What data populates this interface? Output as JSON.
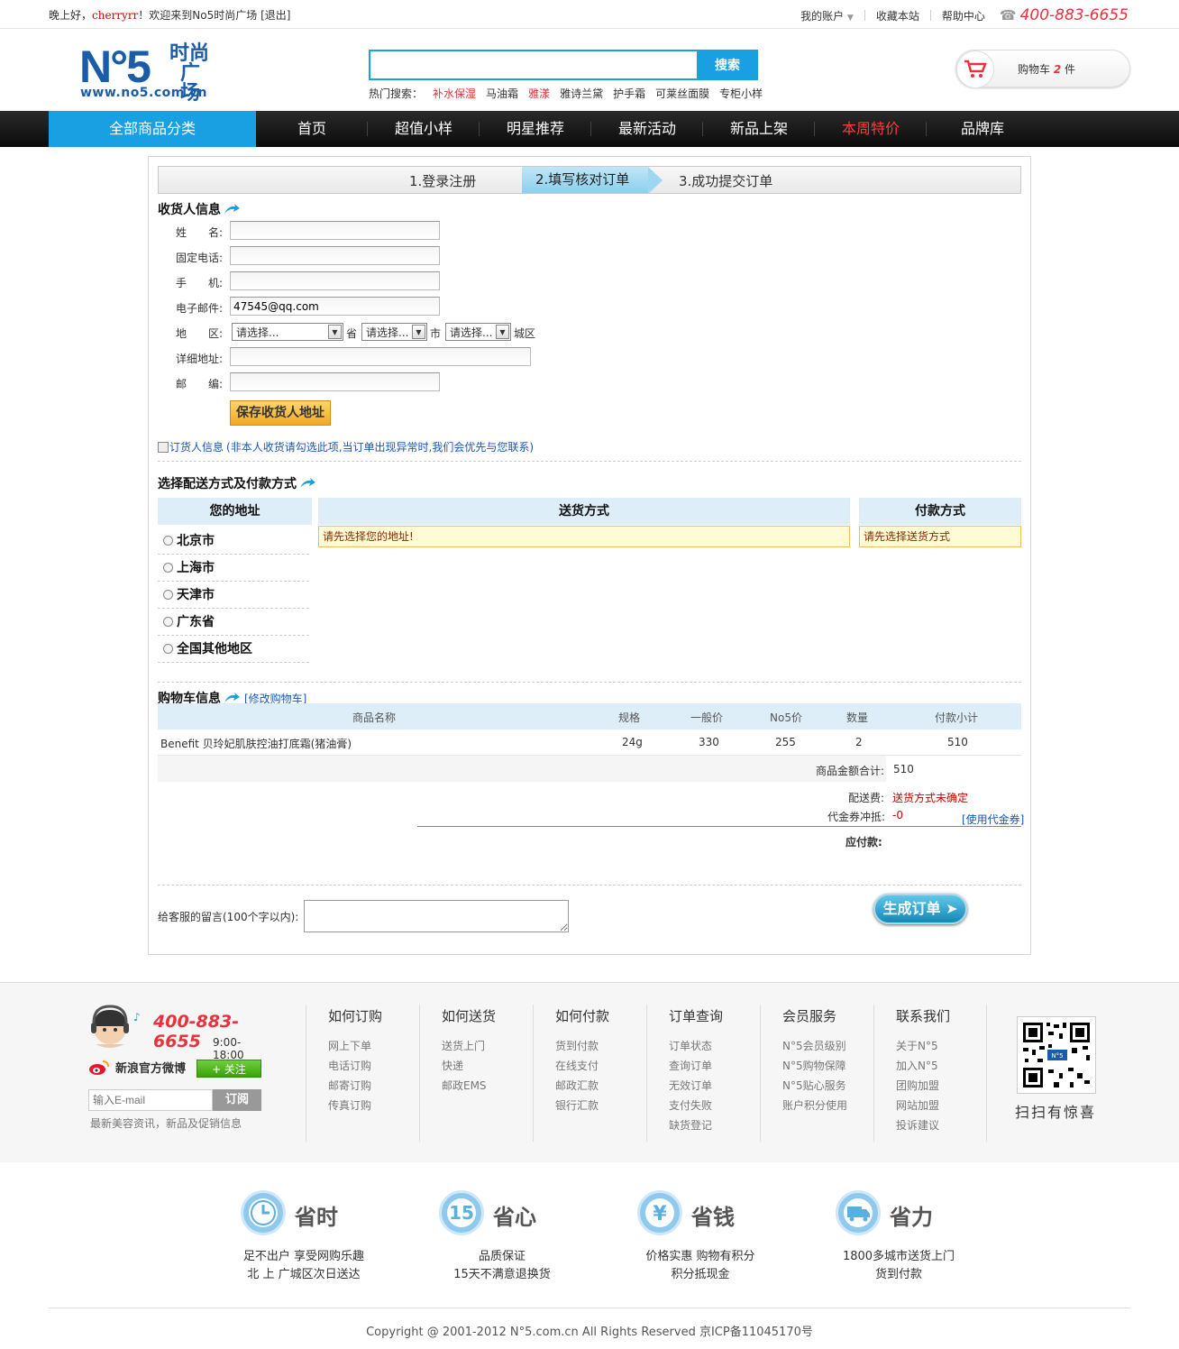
{
  "topbar": {
    "greeting_prefix": "晚上好，",
    "username": "cherryrr",
    "greeting_suffix": "！欢迎来到No5时尚广场",
    "logout": "[退出]",
    "my_account": "我的账户",
    "bookmark": "收藏本站",
    "help": "帮助中心",
    "phone": "400-883-6655"
  },
  "logo": {
    "mark": "N°5",
    "cn_line1": "时尚",
    "cn_line2": "广场",
    "url": "www.no5.com.cn"
  },
  "search": {
    "value": "",
    "button": "搜索",
    "hot_label": "热门搜索：",
    "hot": [
      {
        "text": "补水保湿",
        "highlight": true
      },
      {
        "text": "马油霜",
        "highlight": false
      },
      {
        "text": "雅漾",
        "highlight": true
      },
      {
        "text": "雅诗兰黛",
        "highlight": false
      },
      {
        "text": "护手霜",
        "highlight": false
      },
      {
        "text": "可莱丝面膜",
        "highlight": false
      },
      {
        "text": "专柜小样",
        "highlight": false
      }
    ]
  },
  "cart": {
    "label": "购物车",
    "count": "2",
    "unit": "件"
  },
  "nav": {
    "all": "全部商品分类",
    "items": [
      {
        "label": "首页",
        "highlight": false
      },
      {
        "label": "超值小样",
        "highlight": false
      },
      {
        "label": "明星推荐",
        "highlight": false
      },
      {
        "label": "最新活动",
        "highlight": false
      },
      {
        "label": "新品上架",
        "highlight": false
      },
      {
        "label": "本周特价",
        "highlight": true
      },
      {
        "label": "品牌库",
        "highlight": false
      }
    ]
  },
  "steps": {
    "s1": "1.登录注册",
    "s2": "2.填写核对订单",
    "s3": "3.成功提交订单"
  },
  "receiver": {
    "title": "收货人信息",
    "name_label": "姓　　名:",
    "tel_label": "固定电话:",
    "mobile_label": "手　　机:",
    "email_label": "电子邮件:",
    "email_value": "47545@qq.com",
    "region_label": "地　　区:",
    "province_sel": "请选择...",
    "province_unit": "省",
    "city_sel": "请选择...",
    "city_unit": "市",
    "district_sel": "请选择...",
    "district_unit": "城区",
    "addr_label": "详细地址:",
    "zip_label": "邮　　编:",
    "save": "保存收货人地址",
    "orderer_check": "订货人信息",
    "orderer_note": "(非本人收货请勾选此项,当订单出现异常时,我们会优先与您联系)"
  },
  "shipping": {
    "title": "选择配送方式及付款方式",
    "col_addr": "您的地址",
    "col_ship": "送货方式",
    "col_pay": "付款方式",
    "ship_warn": "请先选择您的地址!",
    "pay_warn": "请先选择送货方式",
    "regions": [
      "北京市",
      "上海市",
      "天津市",
      "广东省",
      "全国其他地区"
    ]
  },
  "cartinfo": {
    "title": "购物车信息",
    "edit": "[修改购物车]",
    "headers": [
      "商品名称",
      "规格",
      "一般价",
      "No5价",
      "数量",
      "付款小计"
    ],
    "rows": [
      {
        "name": "Benefit 贝玲妃肌肤控油打底霜(猪油膏)",
        "spec": "24g",
        "price": "330",
        "no5": "255",
        "qty": "2",
        "subtotal": "510"
      }
    ],
    "total_label": "商品金额合计:",
    "total": "510",
    "ship_fee_label": "配送费:",
    "ship_fee": "送货方式未确定",
    "coupon_label": "代金券冲抵:",
    "coupon": "-0",
    "use_coupon": "[使用代金券]",
    "payable_label": "应付款:"
  },
  "message": {
    "label": "给客服的留言(100个字以内):",
    "submit": "生成订单"
  },
  "footer": {
    "phone": "400-883-6655",
    "hours": "9:00-18:00",
    "weibo": "新浪官方微博",
    "follow": "+ 关注",
    "email_placeholder": "输入E-mail",
    "subscribe": "订阅",
    "tip": "最新美容资讯，新品及促销信息",
    "columns": [
      {
        "title": "如何订购",
        "items": [
          "网上下单",
          "电话订购",
          "邮寄订购",
          "传真订购"
        ]
      },
      {
        "title": "如何送货",
        "items": [
          "送货上门",
          "快递",
          "邮政EMS"
        ]
      },
      {
        "title": "如何付款",
        "items": [
          "货到付款",
          "在线支付",
          "邮政汇款",
          "银行汇款"
        ]
      },
      {
        "title": "订单查询",
        "items": [
          "订单状态",
          "查询订单",
          "无效订单",
          "支付失败",
          "缺货登记"
        ]
      },
      {
        "title": "会员服务",
        "items": [
          "N°5会员级别",
          "N°5购物保障",
          "N°5贴心服务",
          "账户积分使用"
        ]
      },
      {
        "title": "联系我们",
        "items": [
          "关于N°5",
          "加入N°5",
          "团购加盟",
          "网站加盟",
          "投诉建议"
        ]
      }
    ],
    "qr_caption": "扫扫有惊喜"
  },
  "features": [
    {
      "title": "省时",
      "line1": "足不出户 享受网购乐趣",
      "line2": "北 上 广城区次日送达",
      "icon": "clock-icon"
    },
    {
      "title": "省心",
      "line1": "品质保证",
      "line2": "15天不满意退换货",
      "icon": "fifteen-icon"
    },
    {
      "title": "省钱",
      "line1": "价格实惠 购物有积分",
      "line2": "积分抵现金",
      "icon": "yuan-icon"
    },
    {
      "title": "省力",
      "line1": "1800多城市送货上门",
      "line2": "货到付款",
      "icon": "truck-icon"
    }
  ],
  "copyright": "Copyright @ 2001-2012 N°5.com.cn All Rights Reserved 京ICP备11045170号"
}
